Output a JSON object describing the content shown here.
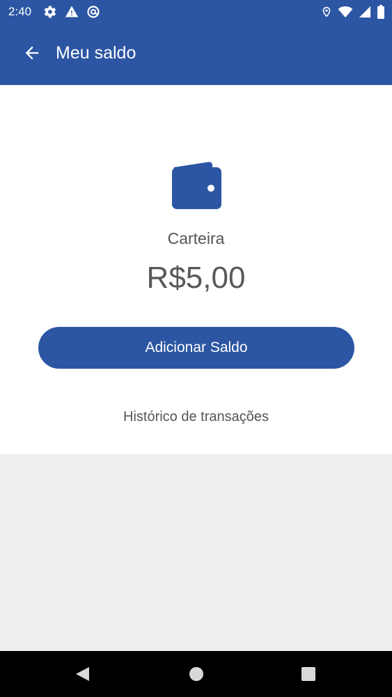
{
  "status_bar": {
    "time": "2:40",
    "left_icons": [
      "gear-icon",
      "warning-icon",
      "at-icon"
    ],
    "right_icons": [
      "location-icon",
      "wifi-icon",
      "signal-icon",
      "battery-icon"
    ]
  },
  "app_bar": {
    "title": "Meu saldo",
    "back_icon": "arrow-left-icon"
  },
  "wallet": {
    "icon": "wallet-icon",
    "label": "Carteira",
    "balance": "R$5,00"
  },
  "actions": {
    "add_balance_label": "Adicionar Saldo",
    "history_label": "Histórico de transações"
  },
  "navigation": {
    "icons": [
      "nav-back-icon",
      "nav-home-icon",
      "nav-recents-icon"
    ]
  },
  "colors": {
    "primary": "#2c56a3",
    "surface": "#ffffff",
    "background": "#eeedef",
    "text": "#555555",
    "nav_bar": "#000000"
  }
}
